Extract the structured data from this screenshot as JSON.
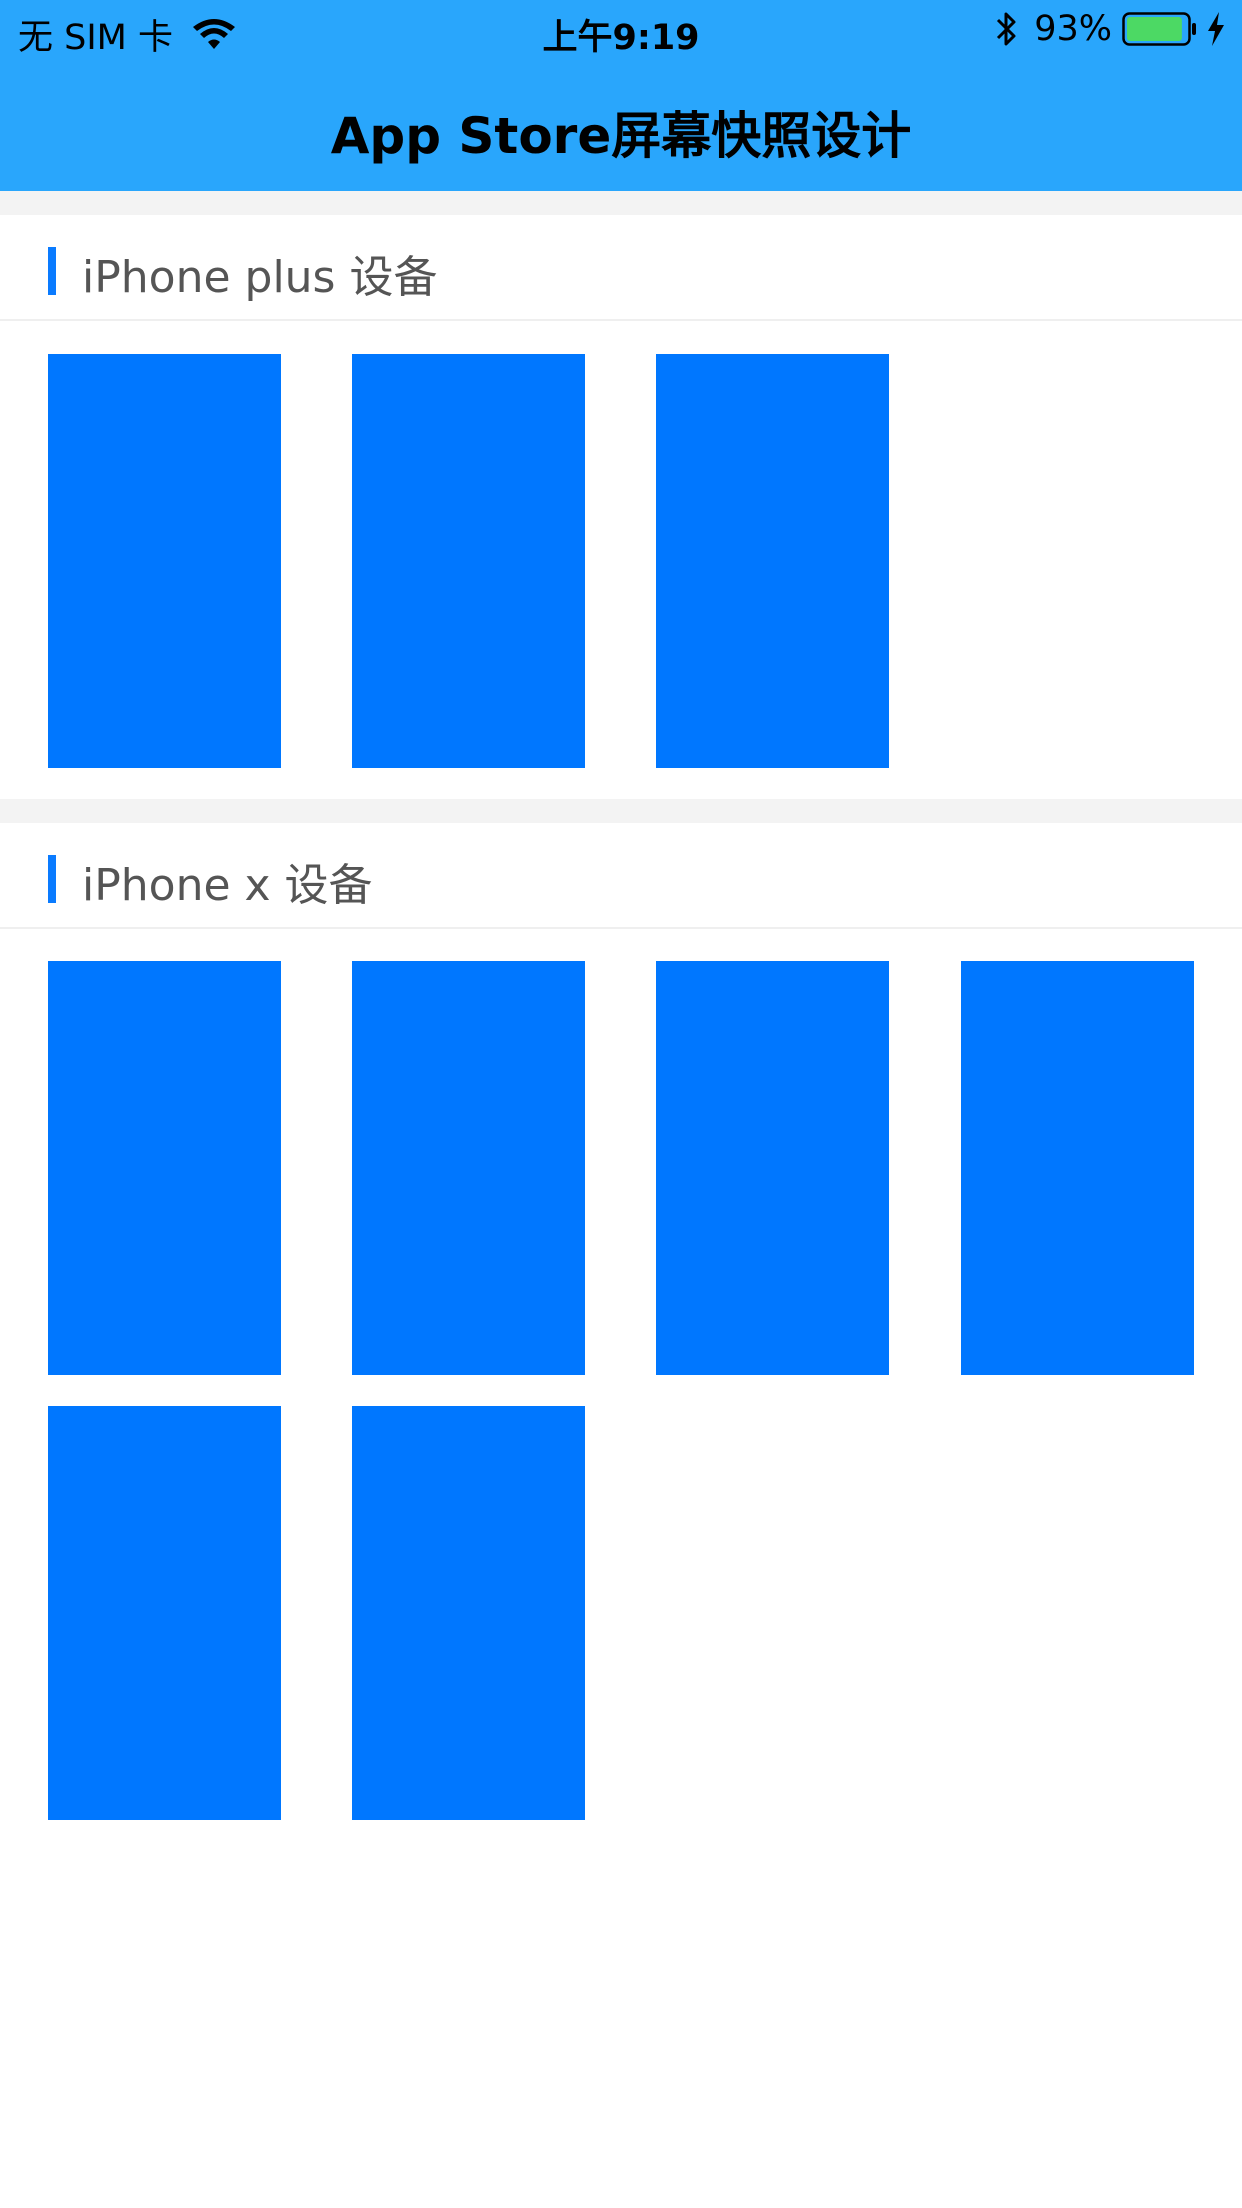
{
  "status_bar": {
    "carrier": "无 SIM 卡",
    "time": "上午9:19",
    "battery_percent": "93%",
    "battery_level": 0.93,
    "wifi_icon": "wifi-icon",
    "bluetooth_icon": "bluetooth-icon",
    "battery_icon": "battery-icon",
    "charging_icon": "charging-bolt-icon"
  },
  "nav": {
    "title": "App Store屏幕快照设计"
  },
  "colors": {
    "header_bg": "#29A6FC",
    "accent": "#0077FF",
    "section_bar": "#0A7BFF",
    "divider": "#F3F3F3",
    "battery_fill": "#4CD964"
  },
  "sections": [
    {
      "title": "iPhone plus 设备",
      "screenshot_count": 3
    },
    {
      "title": "iPhone x 设备",
      "screenshot_count": 6
    }
  ]
}
